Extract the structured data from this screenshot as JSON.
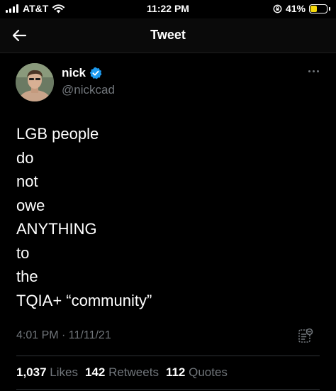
{
  "status_bar": {
    "carrier": "AT&T",
    "time": "11:22 PM",
    "battery_percent": "41%",
    "battery_level": 0.41,
    "battery_color": "#f5d90a"
  },
  "header": {
    "title": "Tweet",
    "back_icon": "arrow-left-icon"
  },
  "tweet": {
    "author_name": "nick",
    "author_handle": "@nickcad",
    "verified": true,
    "verified_color": "#1d9bf0",
    "lines": [
      "LGB people",
      "do",
      "not",
      "owe",
      "ANYTHING",
      "to",
      "the",
      "TQIA+ “community”"
    ],
    "timestamp": "4:01 PM · 11/11/21",
    "stats": {
      "likes_count": "1,037",
      "likes_label": "Likes",
      "retweets_count": "142",
      "retweets_label": "Retweets",
      "quotes_count": "112",
      "quotes_label": "Quotes"
    }
  }
}
